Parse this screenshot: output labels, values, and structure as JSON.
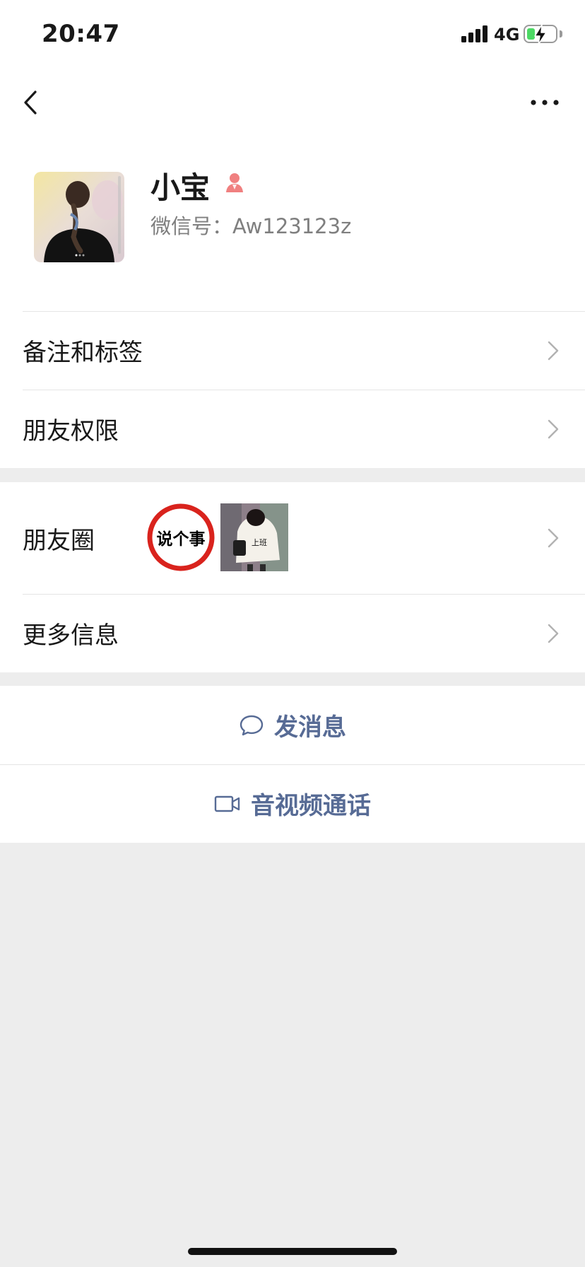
{
  "status_bar": {
    "time": "20:47",
    "network": "4G",
    "battery_level": 0.3,
    "signal_icon": "signal-bars-icon",
    "battery_icon": "battery-charging-icon"
  },
  "nav": {
    "back_icon": "chevron-left-icon",
    "more_icon": "ellipsis-icon"
  },
  "profile": {
    "name": "小宝",
    "gender_icon": "female-icon",
    "gender_color": "#fa5151",
    "wechat_id": "微信号：Aw123123z"
  },
  "settings_rows": [
    {
      "label": "备注和标签"
    },
    {
      "label": "朋友权限"
    }
  ],
  "moments": {
    "label": "朋友圈",
    "thumbnails": [
      {
        "text": "说个事"
      },
      {
        "text": "上班"
      }
    ]
  },
  "more_info": {
    "label": "更多信息"
  },
  "actions": {
    "message": {
      "label": "发消息",
      "icon": "chat-bubble-icon"
    },
    "call": {
      "label": "音视频通话",
      "icon": "video-camera-icon"
    }
  },
  "colors": {
    "link": "#576b95",
    "background": "#ededed",
    "surface": "#ffffff"
  }
}
